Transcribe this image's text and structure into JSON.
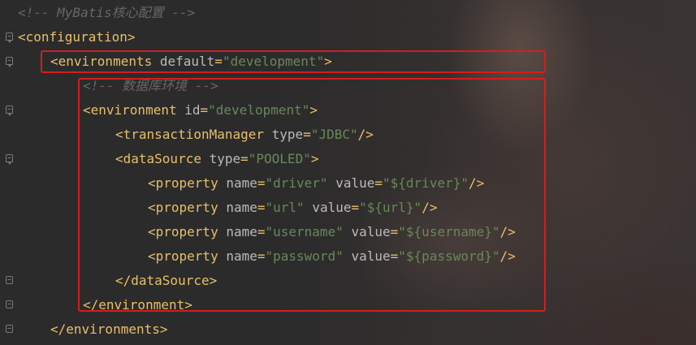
{
  "editor": {
    "lines": [
      {
        "indent": 0,
        "parts": [
          {
            "t": "cmt",
            "v": "<!-- MyBatis核心配置 -->"
          }
        ],
        "fold": ""
      },
      {
        "indent": 0,
        "parts": [
          {
            "t": "tag",
            "v": "<configuration>"
          }
        ],
        "fold": "open"
      },
      {
        "indent": 1,
        "parts": [
          {
            "t": "tag",
            "v": "<environments "
          },
          {
            "t": "attr",
            "v": "default"
          },
          {
            "t": "tag",
            "v": "="
          },
          {
            "t": "val",
            "v": "\"development\""
          },
          {
            "t": "tag",
            "v": ">"
          }
        ],
        "fold": "open"
      },
      {
        "indent": 2,
        "parts": [
          {
            "t": "cmt",
            "v": "<!-- 数据库环境 -->"
          }
        ],
        "fold": ""
      },
      {
        "indent": 2,
        "parts": [
          {
            "t": "tag",
            "v": "<environment "
          },
          {
            "t": "attr",
            "v": "id"
          },
          {
            "t": "tag",
            "v": "="
          },
          {
            "t": "val",
            "v": "\"development\""
          },
          {
            "t": "tag",
            "v": ">"
          }
        ],
        "fold": "open"
      },
      {
        "indent": 3,
        "parts": [
          {
            "t": "tag",
            "v": "<transactionManager "
          },
          {
            "t": "attr",
            "v": "type"
          },
          {
            "t": "tag",
            "v": "="
          },
          {
            "t": "val",
            "v": "\"JDBC\""
          },
          {
            "t": "tag",
            "v": "/>"
          }
        ],
        "fold": ""
      },
      {
        "indent": 3,
        "parts": [
          {
            "t": "tag",
            "v": "<dataSource "
          },
          {
            "t": "attr",
            "v": "type"
          },
          {
            "t": "tag",
            "v": "="
          },
          {
            "t": "val",
            "v": "\"POOLED\""
          },
          {
            "t": "tag",
            "v": ">"
          }
        ],
        "fold": "open"
      },
      {
        "indent": 4,
        "parts": [
          {
            "t": "tag",
            "v": "<property "
          },
          {
            "t": "attr",
            "v": "name"
          },
          {
            "t": "tag",
            "v": "="
          },
          {
            "t": "val",
            "v": "\"driver\""
          },
          {
            "t": "tag",
            "v": " "
          },
          {
            "t": "attr",
            "v": "value"
          },
          {
            "t": "tag",
            "v": "="
          },
          {
            "t": "val",
            "v": "\"${driver}\""
          },
          {
            "t": "tag",
            "v": "/>"
          }
        ],
        "fold": ""
      },
      {
        "indent": 4,
        "parts": [
          {
            "t": "tag",
            "v": "<property "
          },
          {
            "t": "attr",
            "v": "name"
          },
          {
            "t": "tag",
            "v": "="
          },
          {
            "t": "val",
            "v": "\"url\""
          },
          {
            "t": "tag",
            "v": " "
          },
          {
            "t": "attr",
            "v": "value"
          },
          {
            "t": "tag",
            "v": "="
          },
          {
            "t": "val",
            "v": "\"${url}\""
          },
          {
            "t": "tag",
            "v": "/>"
          }
        ],
        "fold": ""
      },
      {
        "indent": 4,
        "parts": [
          {
            "t": "tag",
            "v": "<property "
          },
          {
            "t": "attr",
            "v": "name"
          },
          {
            "t": "tag",
            "v": "="
          },
          {
            "t": "val",
            "v": "\"username\""
          },
          {
            "t": "tag",
            "v": " "
          },
          {
            "t": "attr",
            "v": "value"
          },
          {
            "t": "tag",
            "v": "="
          },
          {
            "t": "val",
            "v": "\"${username}\""
          },
          {
            "t": "tag",
            "v": "/>"
          }
        ],
        "fold": ""
      },
      {
        "indent": 4,
        "parts": [
          {
            "t": "tag",
            "v": "<property "
          },
          {
            "t": "attr",
            "v": "name"
          },
          {
            "t": "tag",
            "v": "="
          },
          {
            "t": "val",
            "v": "\"password\""
          },
          {
            "t": "tag",
            "v": " "
          },
          {
            "t": "attr",
            "v": "value"
          },
          {
            "t": "tag",
            "v": "="
          },
          {
            "t": "val",
            "v": "\"${password}\""
          },
          {
            "t": "tag",
            "v": "/>"
          }
        ],
        "fold": ""
      },
      {
        "indent": 3,
        "parts": [
          {
            "t": "tag",
            "v": "</dataSource>"
          }
        ],
        "fold": "close"
      },
      {
        "indent": 2,
        "parts": [
          {
            "t": "tag",
            "v": "</environment>"
          }
        ],
        "fold": "close"
      },
      {
        "indent": 1,
        "parts": [
          {
            "t": "tag",
            "v": "</environments>"
          }
        ],
        "fold": "close"
      }
    ],
    "colors": {
      "tag": "#e8bf6a",
      "attr": "#bababa",
      "value": "#6a8759",
      "comment": "#676767",
      "highlight": "#d51d1d"
    }
  }
}
